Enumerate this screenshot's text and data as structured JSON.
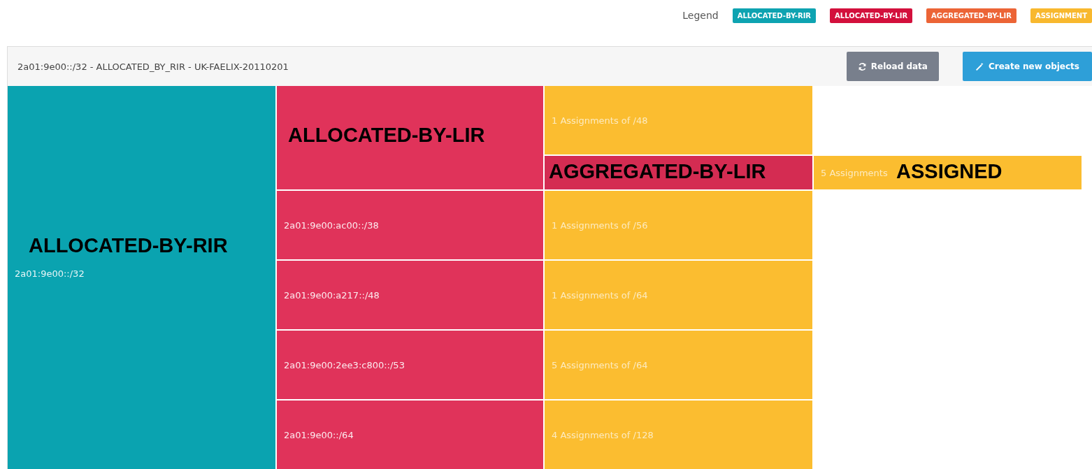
{
  "legend": {
    "label": "Legend",
    "items": [
      {
        "label": "ALLOCATED-BY-RIR",
        "color": "#0ea3b1"
      },
      {
        "label": "ALLOCATED-BY-LIR",
        "color": "#d3103c"
      },
      {
        "label": "AGGREGATED-BY-LIR",
        "color": "#ec6436"
      },
      {
        "label": "ASSIGNMENT",
        "color": "#f8b82e"
      }
    ]
  },
  "panel": {
    "title": "2a01:9e00::/32 - ALLOCATED_BY_RIR - UK-FAELIX-20110201",
    "buttons": [
      {
        "label": "Reload data",
        "kind": "reload"
      },
      {
        "label": "Create new objects",
        "kind": "create"
      }
    ]
  },
  "treemap": {
    "kind": "rir",
    "label": "2a01:9e00::/32",
    "annotation": "ALLOCATED-BY-RIR",
    "children": [
      {
        "kind": "lir",
        "annotation": "ALLOCATED-BY-LIR",
        "children": [
          {
            "kind": "assignment",
            "label": "1 Assignments of /48"
          },
          {
            "kind": "aggregated",
            "annotation": "AGGREGATED-BY-LIR",
            "children": [
              {
                "kind": "assigned",
                "label": "5 Assignments",
                "annotation": "ASSIGNED"
              }
            ]
          }
        ]
      },
      {
        "kind": "lir",
        "label": "2a01:9e00:ac00::/38",
        "children": [
          {
            "kind": "assignment",
            "label": "1 Assignments of /56"
          }
        ]
      },
      {
        "kind": "lir",
        "label": "2a01:9e00:a217::/48",
        "children": [
          {
            "kind": "assignment",
            "label": "1 Assignments of /64"
          }
        ]
      },
      {
        "kind": "lir",
        "label": "2a01:9e00:2ee3:c800::/53",
        "children": [
          {
            "kind": "assignment",
            "label": "5 Assignments of /64"
          }
        ]
      },
      {
        "kind": "lir",
        "label": "2a01:9e00::/64",
        "children": [
          {
            "kind": "assignment",
            "label": "4 Assignments of /128"
          }
        ]
      }
    ]
  }
}
